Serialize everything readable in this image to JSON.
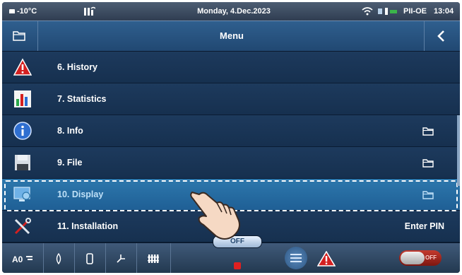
{
  "status_bar": {
    "outdoor_temp": "-10°C",
    "date": "Monday, 4.Dec.2023",
    "mode": "PII-OE",
    "time": "13:04"
  },
  "title_bar": {
    "title": "Menu"
  },
  "menu": {
    "items": [
      {
        "label": "6.  History",
        "icon": "warning-icon"
      },
      {
        "label": "7.  Statistics",
        "icon": "bar-chart-icon"
      },
      {
        "label": "8.  Info",
        "icon": "info-icon"
      },
      {
        "label": "9.  File",
        "icon": "floppy-disk-icon"
      },
      {
        "label": "10. Display",
        "icon": "display-settings-icon"
      },
      {
        "label": "11. Installation",
        "icon": "tools-icon",
        "extra": "Enter PIN"
      }
    ]
  },
  "bottom_bar": {
    "power_label": "OFF",
    "toggle_label": "OFF"
  },
  "colors": {
    "background": "#0f2a49",
    "selected_row": "#2d78ad",
    "warning_red": "#d42020",
    "toggle_red": "#c43a2e"
  }
}
